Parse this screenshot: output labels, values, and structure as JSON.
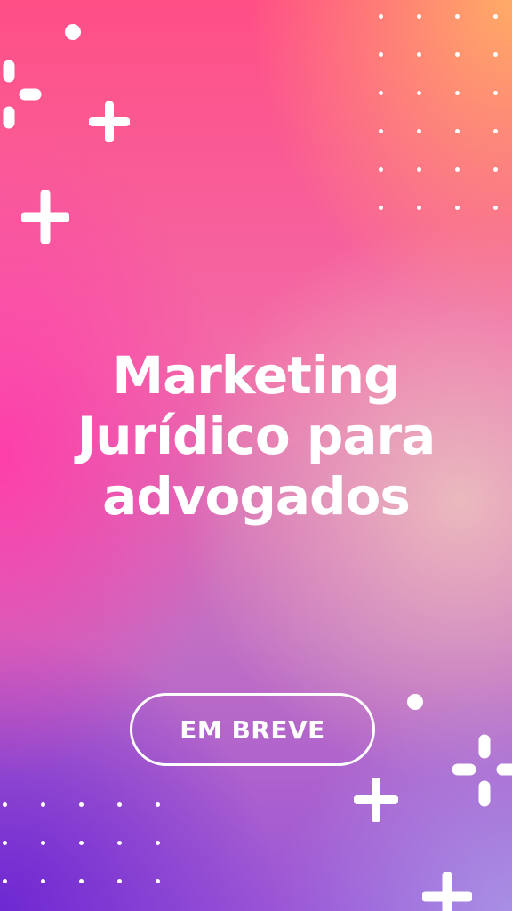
{
  "headline": {
    "line1": "Marketing",
    "line2": "Jurídico para",
    "line3": "advogados"
  },
  "cta": {
    "label": "EM BREVE"
  },
  "colors": {
    "text": "#ffffff",
    "gradient_top_left": "#ff4f86",
    "gradient_top_right": "#ffb064",
    "gradient_left": "#ff3caa",
    "gradient_bottom_left": "#6e28d2",
    "gradient_bottom_right": "#aa96e6"
  },
  "decorations": {
    "sparkle_icon": "four-point-sparkle",
    "dot_grid_icon": "dot-grid"
  }
}
